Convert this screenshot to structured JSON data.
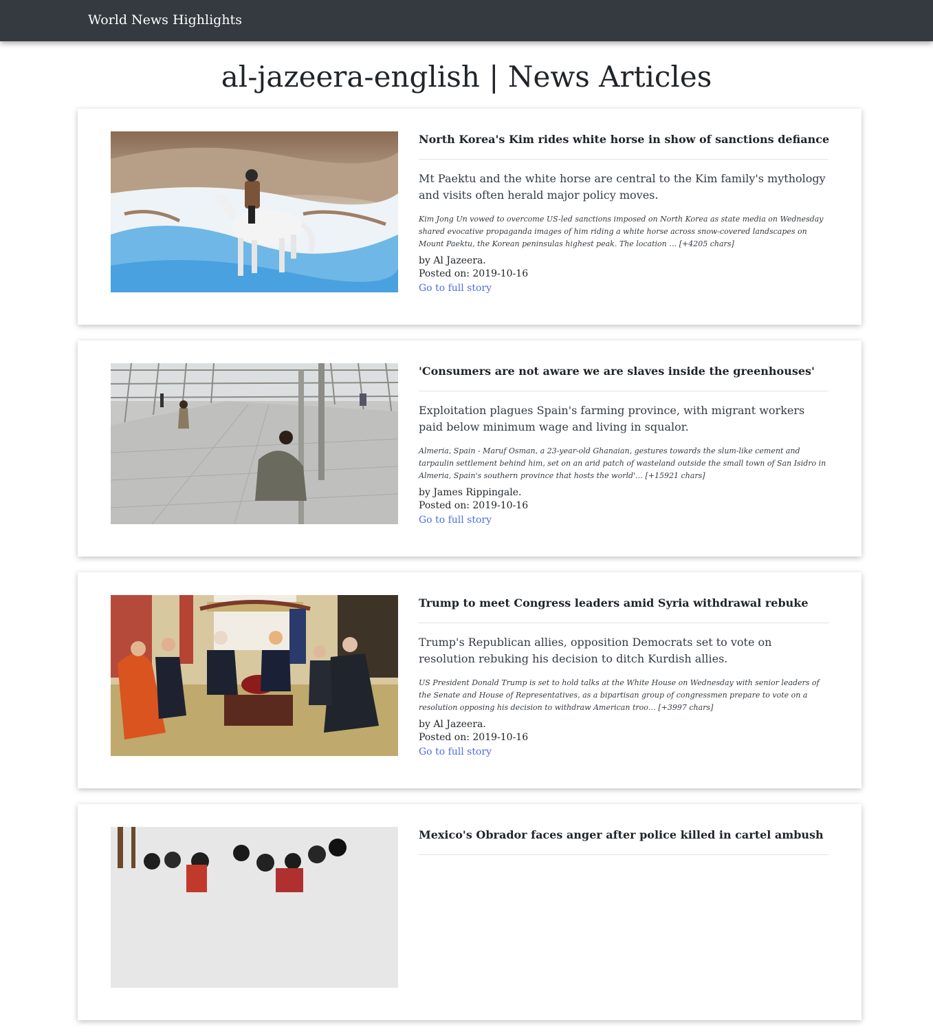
{
  "navbar": {
    "brand": "World News Highlights"
  },
  "page": {
    "title": "al-jazeera-english | News Articles"
  },
  "articles": [
    {
      "title": "North Korea's Kim rides white horse in show of sanctions defiance",
      "description": "Mt Paektu and the white horse are central to the Kim family's mythology and visits often herald major policy moves.",
      "content": "Kim Jong Un vowed to overcome US-led sanctions imposed on North Korea as state media on Wednesday shared evocative propaganda images of him riding a white horse across snow-covered landscapes on Mount Paektu, the Korean peninsulas highest peak. The location … [+4205 chars]",
      "author": "by Al Jazeera.",
      "posted": "Posted on: 2019-10-16",
      "link_label": "Go to full story"
    },
    {
      "title": "'Consumers are not aware we are slaves inside the greenhouses'",
      "description": "Exploitation plagues Spain's farming province, with migrant workers paid below minimum wage and living in squalor.",
      "content": "Almeria, Spain - Maruf Osman, a 23-year-old Ghanaian, gestures towards the slum-like cement and tarpaulin settlement behind him, set on an arid patch of wasteland outside the small town of San Isidro in Almeria, Spain's southern province that hosts the world'… [+15921 chars]",
      "author": "by James Rippingale.",
      "posted": "Posted on: 2019-10-16",
      "link_label": "Go to full story"
    },
    {
      "title": "Trump to meet Congress leaders amid Syria withdrawal rebuke",
      "description": "Trump's Republican allies, opposition Democrats set to vote on resolution rebuking his decision to ditch Kurdish allies.",
      "content": "US President Donald Trump is set to hold talks at the White House on Wednesday with senior leaders of the Senate and House of Representatives, as a bipartisan group of congressmen prepare to vote on a resolution opposing his decision to withdraw American troo… [+3997 chars]",
      "author": "by Al Jazeera.",
      "posted": "Posted on: 2019-10-16",
      "link_label": "Go to full story"
    },
    {
      "title": "Mexico's Obrador faces anger after police killed in cartel ambush"
    }
  ]
}
